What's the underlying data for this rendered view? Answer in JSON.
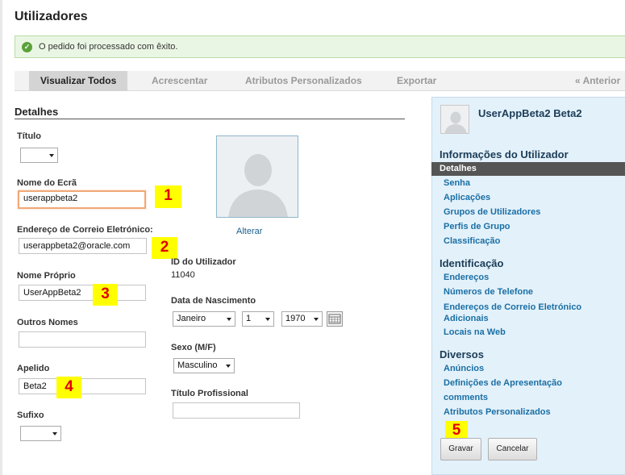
{
  "page": {
    "title": "Utilizadores"
  },
  "alert": {
    "message": "O pedido foi processado com êxito."
  },
  "tabs": [
    {
      "label": "Visualizar Todos"
    },
    {
      "label": "Acrescentar"
    },
    {
      "label": "Atributos Personalizados"
    },
    {
      "label": "Exportar"
    }
  ],
  "nav": {
    "previous": "« Anterior"
  },
  "details": {
    "heading": "Detalhes",
    "title_label": "Título",
    "screen_name_label": "Nome do Ecrã",
    "screen_name_value": "userappbeta2",
    "email_label": "Endereço de Correio Eletrónico:",
    "email_value": "userappbeta2@oracle.com",
    "first_name_label": "Nome Próprio",
    "first_name_value": "UserAppBeta2",
    "middle_name_label": "Outros Nomes",
    "middle_name_value": "",
    "last_name_label": "Apelido",
    "last_name_value": "Beta2",
    "suffix_label": "Sufixo",
    "photo_change_link": "Alterar",
    "user_id_label": "ID do Utilizador",
    "user_id_value": "11040",
    "birthday_label": "Data de Nascimento",
    "birth_month": "Janeiro",
    "birth_day": "1",
    "birth_year": "1970",
    "gender_label": "Sexo (M/F)",
    "gender_value": "Masculino",
    "job_title_label": "Título Profissional",
    "job_title_value": ""
  },
  "annotations": [
    "1",
    "2",
    "3",
    "4",
    "5"
  ],
  "sidebar": {
    "user_name": "UserAppBeta2 Beta2",
    "sections": [
      {
        "heading": "Informações do Utilizador",
        "items": [
          "Detalhes",
          "Senha",
          "Aplicações",
          "Grupos de Utilizadores",
          "Perfis de Grupo",
          "Classificação"
        ]
      },
      {
        "heading": "Identificação",
        "items": [
          "Endereços",
          "Números de Telefone",
          "Endereços de Correio Eletrónico Adicionais",
          "Locais na Web"
        ]
      },
      {
        "heading": "Diversos",
        "items": [
          "Anúncios",
          "Definições de Apresentação",
          "comments",
          "Atributos Personalizados"
        ]
      }
    ],
    "save_button": "Gravar",
    "cancel_button": "Cancelar"
  },
  "colors": {
    "accent_link": "#1a6fa5",
    "sidebar_bg": "#e3f1fa",
    "success_bg": "#eaf6e4",
    "badge_bg": "#ffff00",
    "badge_text": "#e00000"
  }
}
